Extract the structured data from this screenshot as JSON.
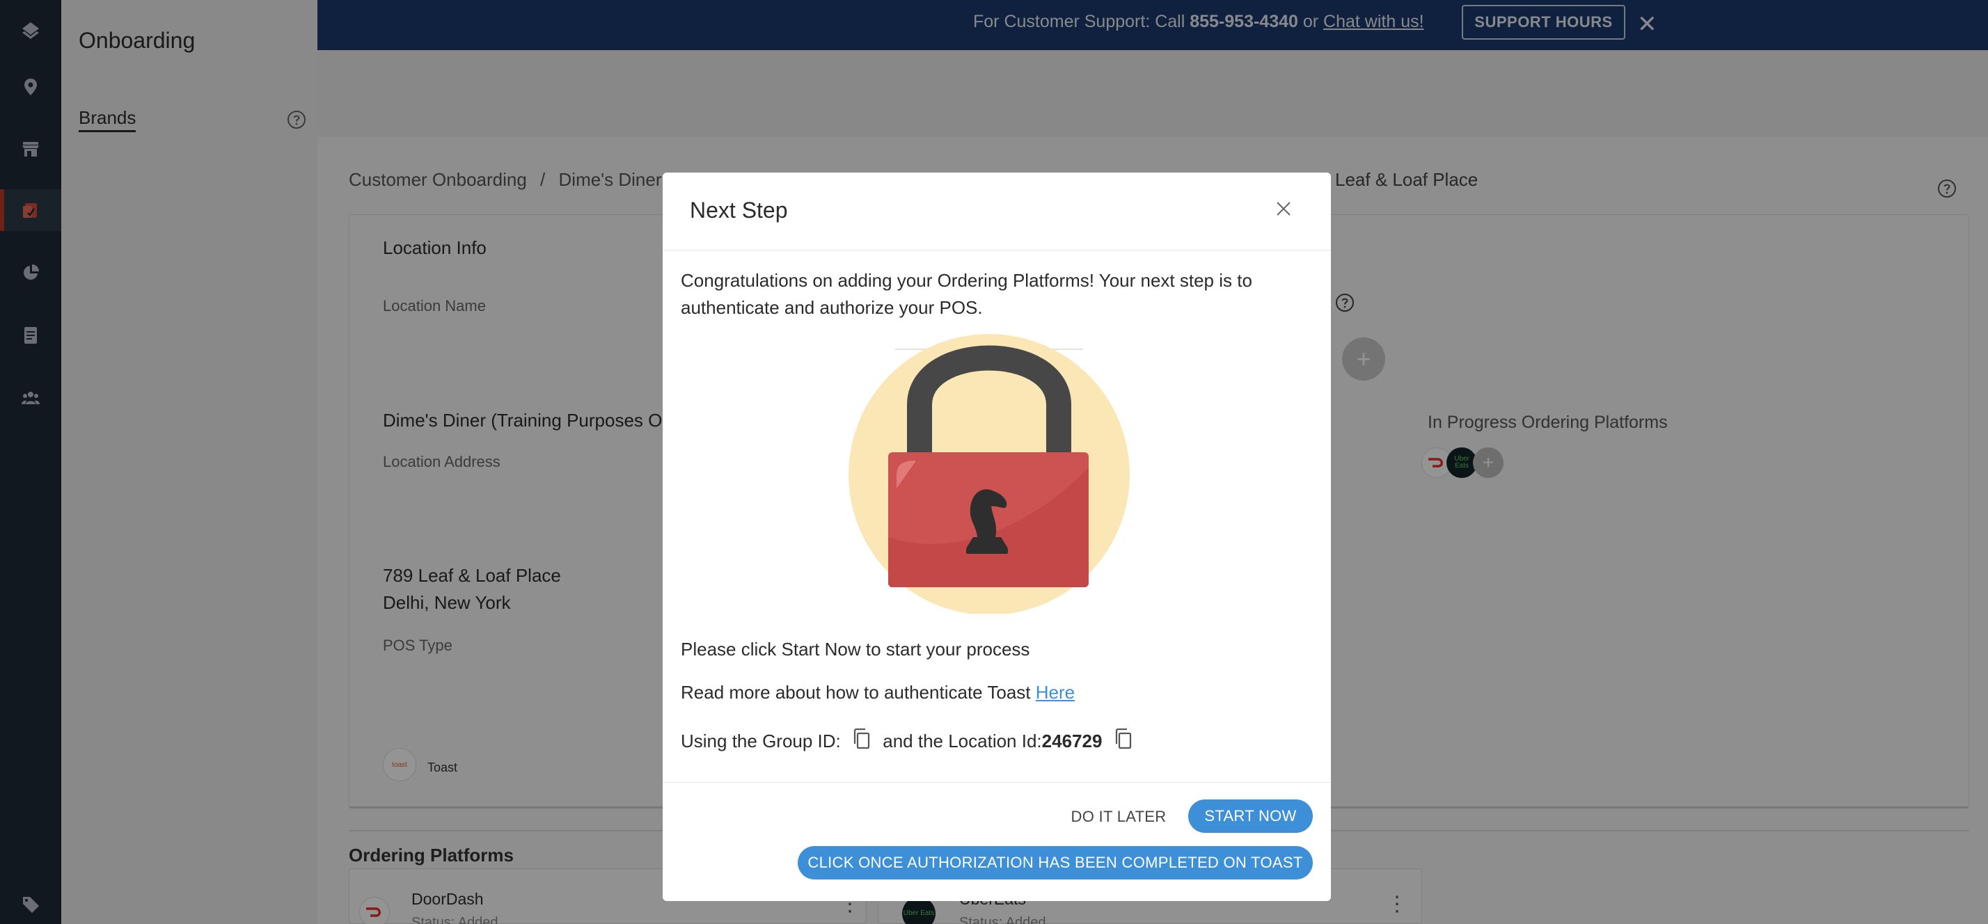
{
  "sidebar": {
    "title": "Onboarding",
    "items": [
      {
        "label": "Brands"
      }
    ]
  },
  "banner": {
    "prefix": "For Customer Support: Call ",
    "phone": "855-953-4340",
    "or": " or ",
    "chat_link": "Chat with us!",
    "hours_button": "SUPPORT HOURS"
  },
  "breadcrumb": {
    "root": "Customer Onboarding",
    "separator": "/",
    "current": "Dime's Diner (",
    "tail": "Leaf & Loaf Place"
  },
  "location": {
    "section_title": "Location Info",
    "name_label": "Location Name",
    "name_value": "Dime's Diner (Training Purposes On",
    "address_label": "Location Address",
    "address_line1": "789 Leaf & Loaf Place",
    "address_line2": "Delhi, New York",
    "pos_label": "POS Type",
    "pos_value": "Toast",
    "pos_logo_text": "toast",
    "in_progress_label": "In Progress Ordering Platforms",
    "uber_logo_text": "Uber Eats"
  },
  "ordering": {
    "title": "Ordering Platforms",
    "platforms": [
      {
        "name": "DoorDash",
        "status": "Status: Added"
      },
      {
        "name": "UberEats",
        "status": "Status: Added"
      }
    ]
  },
  "modal": {
    "title": "Next Step",
    "intro_line1": "Congratulations on adding your Ordering Platforms! Your next step is to",
    "intro_line2": "authenticate and authorize your POS.",
    "click_start": "Please click Start Now to start your process",
    "read_more": "Read more about how to authenticate Toast ",
    "here_link": "Here",
    "group_id_label": "Using the Group ID:",
    "location_id_label": "and the Location Id:",
    "location_id": "246729",
    "do_it_later": "DO IT LATER",
    "start_now": "START NOW",
    "confirm": "CLICK ONCE AUTHORIZATION HAS BEEN COMPLETED ON TOAST"
  },
  "colors": {
    "banner": "#1a3a6b",
    "rail": "#1e2a36",
    "accent": "#3d8fd8",
    "lock_red": "#cd5252",
    "lock_bg": "#fbe7b5"
  },
  "icons": [
    "logo-icon",
    "location-pin-icon",
    "store-icon",
    "onboarding-icon",
    "pie-chart-icon",
    "document-icon",
    "users-icon",
    "tag-icon",
    "help-icon",
    "close-icon",
    "copy-icon",
    "lock-icon"
  ]
}
